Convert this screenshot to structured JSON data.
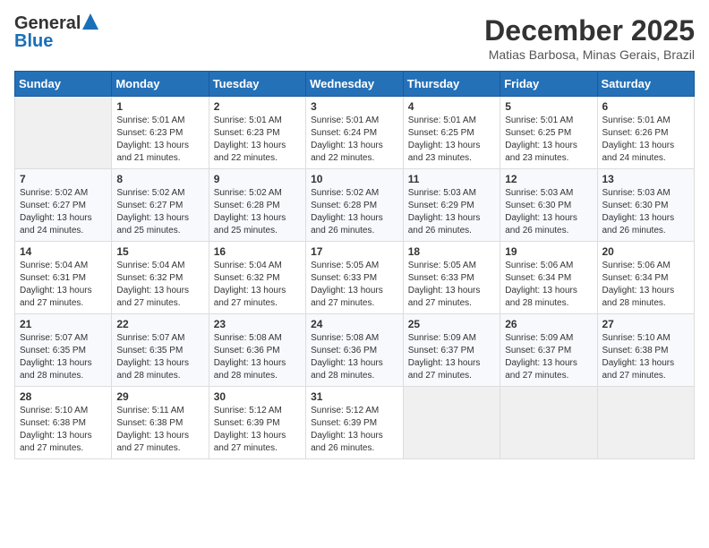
{
  "header": {
    "logo_general": "General",
    "logo_blue": "Blue",
    "month_title": "December 2025",
    "subtitle": "Matias Barbosa, Minas Gerais, Brazil"
  },
  "weekdays": [
    "Sunday",
    "Monday",
    "Tuesday",
    "Wednesday",
    "Thursday",
    "Friday",
    "Saturday"
  ],
  "weeks": [
    [
      {
        "day": "",
        "info": ""
      },
      {
        "day": "1",
        "info": "Sunrise: 5:01 AM\nSunset: 6:23 PM\nDaylight: 13 hours\nand 21 minutes."
      },
      {
        "day": "2",
        "info": "Sunrise: 5:01 AM\nSunset: 6:23 PM\nDaylight: 13 hours\nand 22 minutes."
      },
      {
        "day": "3",
        "info": "Sunrise: 5:01 AM\nSunset: 6:24 PM\nDaylight: 13 hours\nand 22 minutes."
      },
      {
        "day": "4",
        "info": "Sunrise: 5:01 AM\nSunset: 6:25 PM\nDaylight: 13 hours\nand 23 minutes."
      },
      {
        "day": "5",
        "info": "Sunrise: 5:01 AM\nSunset: 6:25 PM\nDaylight: 13 hours\nand 23 minutes."
      },
      {
        "day": "6",
        "info": "Sunrise: 5:01 AM\nSunset: 6:26 PM\nDaylight: 13 hours\nand 24 minutes."
      }
    ],
    [
      {
        "day": "7",
        "info": "Sunrise: 5:02 AM\nSunset: 6:27 PM\nDaylight: 13 hours\nand 24 minutes."
      },
      {
        "day": "8",
        "info": "Sunrise: 5:02 AM\nSunset: 6:27 PM\nDaylight: 13 hours\nand 25 minutes."
      },
      {
        "day": "9",
        "info": "Sunrise: 5:02 AM\nSunset: 6:28 PM\nDaylight: 13 hours\nand 25 minutes."
      },
      {
        "day": "10",
        "info": "Sunrise: 5:02 AM\nSunset: 6:28 PM\nDaylight: 13 hours\nand 26 minutes."
      },
      {
        "day": "11",
        "info": "Sunrise: 5:03 AM\nSunset: 6:29 PM\nDaylight: 13 hours\nand 26 minutes."
      },
      {
        "day": "12",
        "info": "Sunrise: 5:03 AM\nSunset: 6:30 PM\nDaylight: 13 hours\nand 26 minutes."
      },
      {
        "day": "13",
        "info": "Sunrise: 5:03 AM\nSunset: 6:30 PM\nDaylight: 13 hours\nand 26 minutes."
      }
    ],
    [
      {
        "day": "14",
        "info": "Sunrise: 5:04 AM\nSunset: 6:31 PM\nDaylight: 13 hours\nand 27 minutes."
      },
      {
        "day": "15",
        "info": "Sunrise: 5:04 AM\nSunset: 6:32 PM\nDaylight: 13 hours\nand 27 minutes."
      },
      {
        "day": "16",
        "info": "Sunrise: 5:04 AM\nSunset: 6:32 PM\nDaylight: 13 hours\nand 27 minutes."
      },
      {
        "day": "17",
        "info": "Sunrise: 5:05 AM\nSunset: 6:33 PM\nDaylight: 13 hours\nand 27 minutes."
      },
      {
        "day": "18",
        "info": "Sunrise: 5:05 AM\nSunset: 6:33 PM\nDaylight: 13 hours\nand 27 minutes."
      },
      {
        "day": "19",
        "info": "Sunrise: 5:06 AM\nSunset: 6:34 PM\nDaylight: 13 hours\nand 28 minutes."
      },
      {
        "day": "20",
        "info": "Sunrise: 5:06 AM\nSunset: 6:34 PM\nDaylight: 13 hours\nand 28 minutes."
      }
    ],
    [
      {
        "day": "21",
        "info": "Sunrise: 5:07 AM\nSunset: 6:35 PM\nDaylight: 13 hours\nand 28 minutes."
      },
      {
        "day": "22",
        "info": "Sunrise: 5:07 AM\nSunset: 6:35 PM\nDaylight: 13 hours\nand 28 minutes."
      },
      {
        "day": "23",
        "info": "Sunrise: 5:08 AM\nSunset: 6:36 PM\nDaylight: 13 hours\nand 28 minutes."
      },
      {
        "day": "24",
        "info": "Sunrise: 5:08 AM\nSunset: 6:36 PM\nDaylight: 13 hours\nand 28 minutes."
      },
      {
        "day": "25",
        "info": "Sunrise: 5:09 AM\nSunset: 6:37 PM\nDaylight: 13 hours\nand 27 minutes."
      },
      {
        "day": "26",
        "info": "Sunrise: 5:09 AM\nSunset: 6:37 PM\nDaylight: 13 hours\nand 27 minutes."
      },
      {
        "day": "27",
        "info": "Sunrise: 5:10 AM\nSunset: 6:38 PM\nDaylight: 13 hours\nand 27 minutes."
      }
    ],
    [
      {
        "day": "28",
        "info": "Sunrise: 5:10 AM\nSunset: 6:38 PM\nDaylight: 13 hours\nand 27 minutes."
      },
      {
        "day": "29",
        "info": "Sunrise: 5:11 AM\nSunset: 6:38 PM\nDaylight: 13 hours\nand 27 minutes."
      },
      {
        "day": "30",
        "info": "Sunrise: 5:12 AM\nSunset: 6:39 PM\nDaylight: 13 hours\nand 27 minutes."
      },
      {
        "day": "31",
        "info": "Sunrise: 5:12 AM\nSunset: 6:39 PM\nDaylight: 13 hours\nand 26 minutes."
      },
      {
        "day": "",
        "info": ""
      },
      {
        "day": "",
        "info": ""
      },
      {
        "day": "",
        "info": ""
      }
    ]
  ]
}
